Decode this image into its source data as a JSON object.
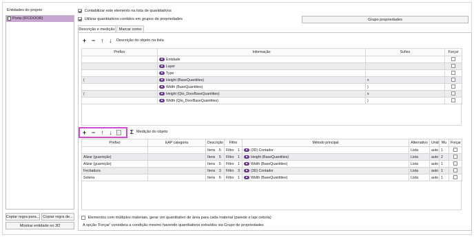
{
  "left_panel": {
    "title": "Entidades do projeto",
    "entity": "Porta (IFCDOOR)",
    "copy_rule_from": "Copiar regra para...",
    "copy_rule_to": "Copiar regra de...",
    "show_entity_3d": "Mostrar entidade no 3D"
  },
  "options": {
    "include_in_list": "Contabilizar este elemento na lista de quantitativos",
    "use_property_groups": "Utilizar quantitativos contidos em grupos de propriedades",
    "property_group_button": "Grupo propriedades"
  },
  "tabs": [
    "Descrição e medição",
    "Marcar como"
  ],
  "description_section": {
    "label": "Descrição do objeto na lista",
    "headers": [
      "Prefixo",
      "Informação",
      "Sufixo",
      "Forçar"
    ],
    "rows": [
      {
        "prefix": "",
        "info": "Entidade",
        "suffix": ""
      },
      {
        "prefix": "",
        "info": "Layer",
        "suffix": ""
      },
      {
        "prefix": "",
        "info": "Type",
        "suffix": ""
      },
      {
        "prefix": "(",
        "info": "Height (BaseQuantities)",
        "suffix": "x"
      },
      {
        "prefix": "",
        "info": "Width (BaseQuantities)",
        "suffix": ")"
      },
      {
        "prefix": "(",
        "info": "Height (Qto_DoorBaseQuantities)",
        "suffix": "x"
      },
      {
        "prefix": "",
        "info": "Width (Qto_DoorBaseQuantities)",
        "suffix": ")"
      }
    ]
  },
  "measure_section": {
    "label": "Medição do objeto",
    "headers": [
      "Prefixo",
      "EAP categoria",
      "Descrição",
      "Filtro",
      "Método principal",
      "Alternativo",
      "Unid",
      "Mu",
      "Forçar"
    ],
    "rows": [
      {
        "prefix": "",
        "eap": "",
        "desc": "Itens",
        "desc_n": "5",
        "filter": "Filtro",
        "filter_n": "1",
        "method": "(3D) Contador",
        "alt": "Lista",
        "unit": "auto",
        "mu": "1"
      },
      {
        "prefix": "Alizar (guarnição)",
        "eap": "",
        "desc": "Itens",
        "desc_n": "5",
        "filter": "Filtro",
        "filter_n": "1",
        "method": "Height (BaseQuantities)",
        "alt": "Lista",
        "unit": "auto",
        "mu": "2"
      },
      {
        "prefix": "Alizar (guarnição)",
        "eap": "",
        "desc": "Itens",
        "desc_n": "5",
        "filter": "Filtro",
        "filter_n": "1",
        "method": "Width (BaseQuantities)",
        "alt": "Lista",
        "unit": "auto",
        "mu": "1"
      },
      {
        "prefix": "Fechadura",
        "eap": "",
        "desc": "Itens",
        "desc_n": "3",
        "filter": "Filtro",
        "filter_n": "3",
        "method": "(3D) Contador",
        "alt": "Lista",
        "unit": "auto",
        "mu": "1"
      },
      {
        "prefix": "Soleira",
        "eap": "",
        "desc": "Itens",
        "desc_n": "6",
        "filter": "Filtro",
        "filter_n": "1",
        "method": "Width (BaseQuantities)",
        "alt": "Lista",
        "unit": "auto",
        "mu": "1"
      }
    ]
  },
  "footer": {
    "multi_material": "Elementos com múltiplos materiais, gerar um quantitativo de área para cada material (parede e laje cebola)",
    "force_note": "A opção 'Forçar' considera a condição mesmo havendo quantitativos extraídos via Grupo de propriedades"
  },
  "colors": {
    "selection": "#c7a7d1",
    "highlight_border": "#d04ad6",
    "alt_row": "#ebebee"
  }
}
